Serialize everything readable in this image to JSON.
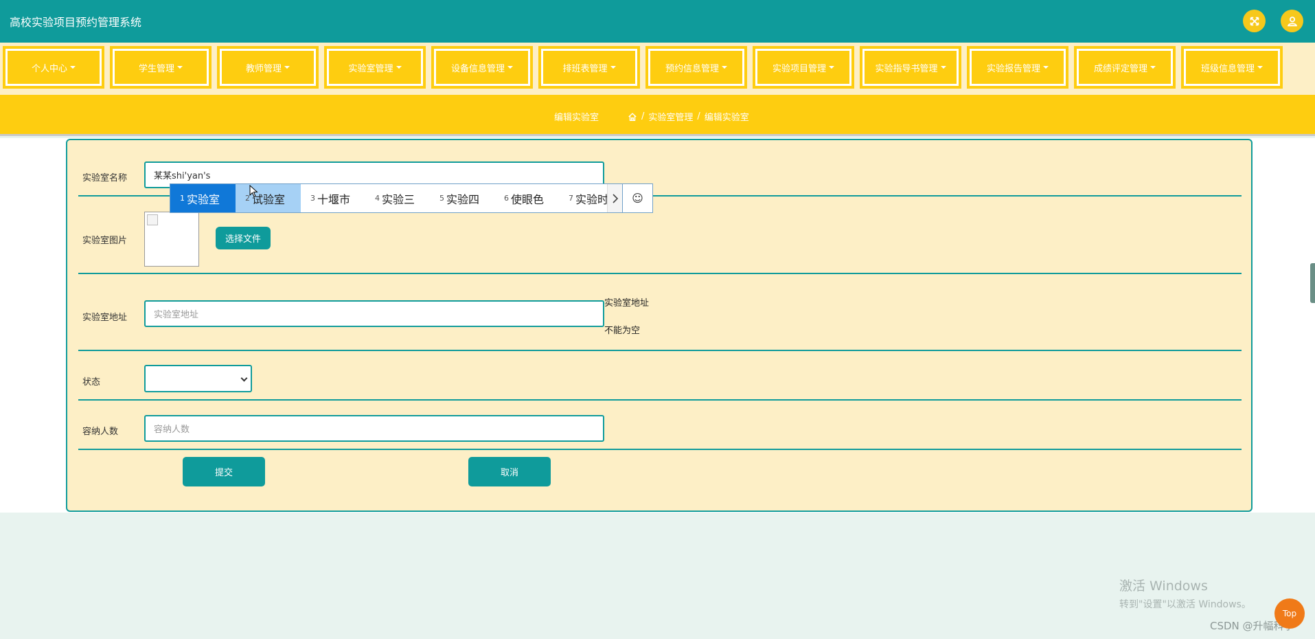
{
  "app": {
    "title": "高校实验项目预约管理系统"
  },
  "header_icons": {
    "fullscreen": "fullscreen-icon",
    "user": "user-icon"
  },
  "nav": {
    "items": [
      {
        "label": "个人中心"
      },
      {
        "label": "学生管理"
      },
      {
        "label": "教师管理"
      },
      {
        "label": "实验室管理"
      },
      {
        "label": "设备信息管理"
      },
      {
        "label": "排班表管理"
      },
      {
        "label": "预约信息管理"
      },
      {
        "label": "实验项目管理"
      },
      {
        "label": "实验指导书管理"
      },
      {
        "label": "实验报告管理"
      },
      {
        "label": "成绩评定管理"
      },
      {
        "label": "班级信息管理"
      }
    ]
  },
  "subheader": {
    "title": "编辑实验室",
    "breadcrumb": {
      "section": "实验室管理",
      "separator": "/",
      "current": "编辑实验室"
    }
  },
  "form": {
    "name": {
      "label": "实验室名称",
      "value": "某某shi'yan's"
    },
    "image": {
      "label": "实验室图片",
      "button": "选择文件"
    },
    "address": {
      "label": "实验室地址",
      "placeholder": "实验室地址",
      "error_line1": "实验室地址",
      "error_line2": "不能为空"
    },
    "status": {
      "label": "状态",
      "value": ""
    },
    "capacity": {
      "label": "容纳人数",
      "placeholder": "容纳人数"
    },
    "submit": "提交",
    "cancel": "取消"
  },
  "ime": {
    "candidates": [
      {
        "num": "1",
        "text": "实验室"
      },
      {
        "num": "2",
        "text": "试验室"
      },
      {
        "num": "3",
        "text": "十堰市"
      },
      {
        "num": "4",
        "text": "实验三"
      },
      {
        "num": "5",
        "text": "实验四"
      },
      {
        "num": "6",
        "text": "使眼色"
      },
      {
        "num": "7",
        "text": "实验时"
      }
    ],
    "emoji": "☺"
  },
  "watermark": {
    "title": "激活 Windows",
    "subtitle": "转到\"设置\"以激活 Windows。"
  },
  "csdn": "CSDN @升幅科学",
  "top_button": "Top",
  "colors": {
    "primary": "#0f9b9b",
    "accent": "#fecd10",
    "card": "#fdefc6"
  }
}
